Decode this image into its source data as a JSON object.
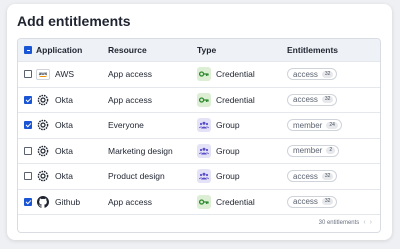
{
  "title": "Add entitlements",
  "columns": {
    "application": "Application",
    "resource": "Resource",
    "type": "Type",
    "entitlements": "Entitlements"
  },
  "header_checkbox_state": "indeterminate",
  "rows": [
    {
      "checked": false,
      "app": "AWS",
      "app_icon": "aws-logo",
      "resource": "App access",
      "type": "Credential",
      "type_icon": "key-icon",
      "entitlement": "access",
      "count": "32"
    },
    {
      "checked": true,
      "app": "Okta",
      "app_icon": "okta-logo",
      "resource": "App access",
      "type": "Credential",
      "type_icon": "key-icon",
      "entitlement": "access",
      "count": "32"
    },
    {
      "checked": true,
      "app": "Okta",
      "app_icon": "okta-logo",
      "resource": "Everyone",
      "type": "Group",
      "type_icon": "people-icon",
      "entitlement": "member",
      "count": "24"
    },
    {
      "checked": false,
      "app": "Okta",
      "app_icon": "okta-logo",
      "resource": "Marketing design",
      "type": "Group",
      "type_icon": "people-icon",
      "entitlement": "member",
      "count": "2"
    },
    {
      "checked": false,
      "app": "Okta",
      "app_icon": "okta-logo",
      "resource": "Product design",
      "type": "Group",
      "type_icon": "people-icon",
      "entitlement": "access",
      "count": "32"
    },
    {
      "checked": true,
      "app": "Github",
      "app_icon": "github-logo",
      "resource": "App access",
      "type": "Credential",
      "type_icon": "key-icon",
      "entitlement": "access",
      "count": "32"
    }
  ],
  "footer": {
    "count_text": "30 entitlements",
    "prev": "‹",
    "next": "›"
  },
  "aws_logo_text": "aws",
  "colors": {
    "accent": "#1a55d6",
    "credential_icon": "#2e8a2e",
    "group_icon": "#5b4fc9"
  }
}
